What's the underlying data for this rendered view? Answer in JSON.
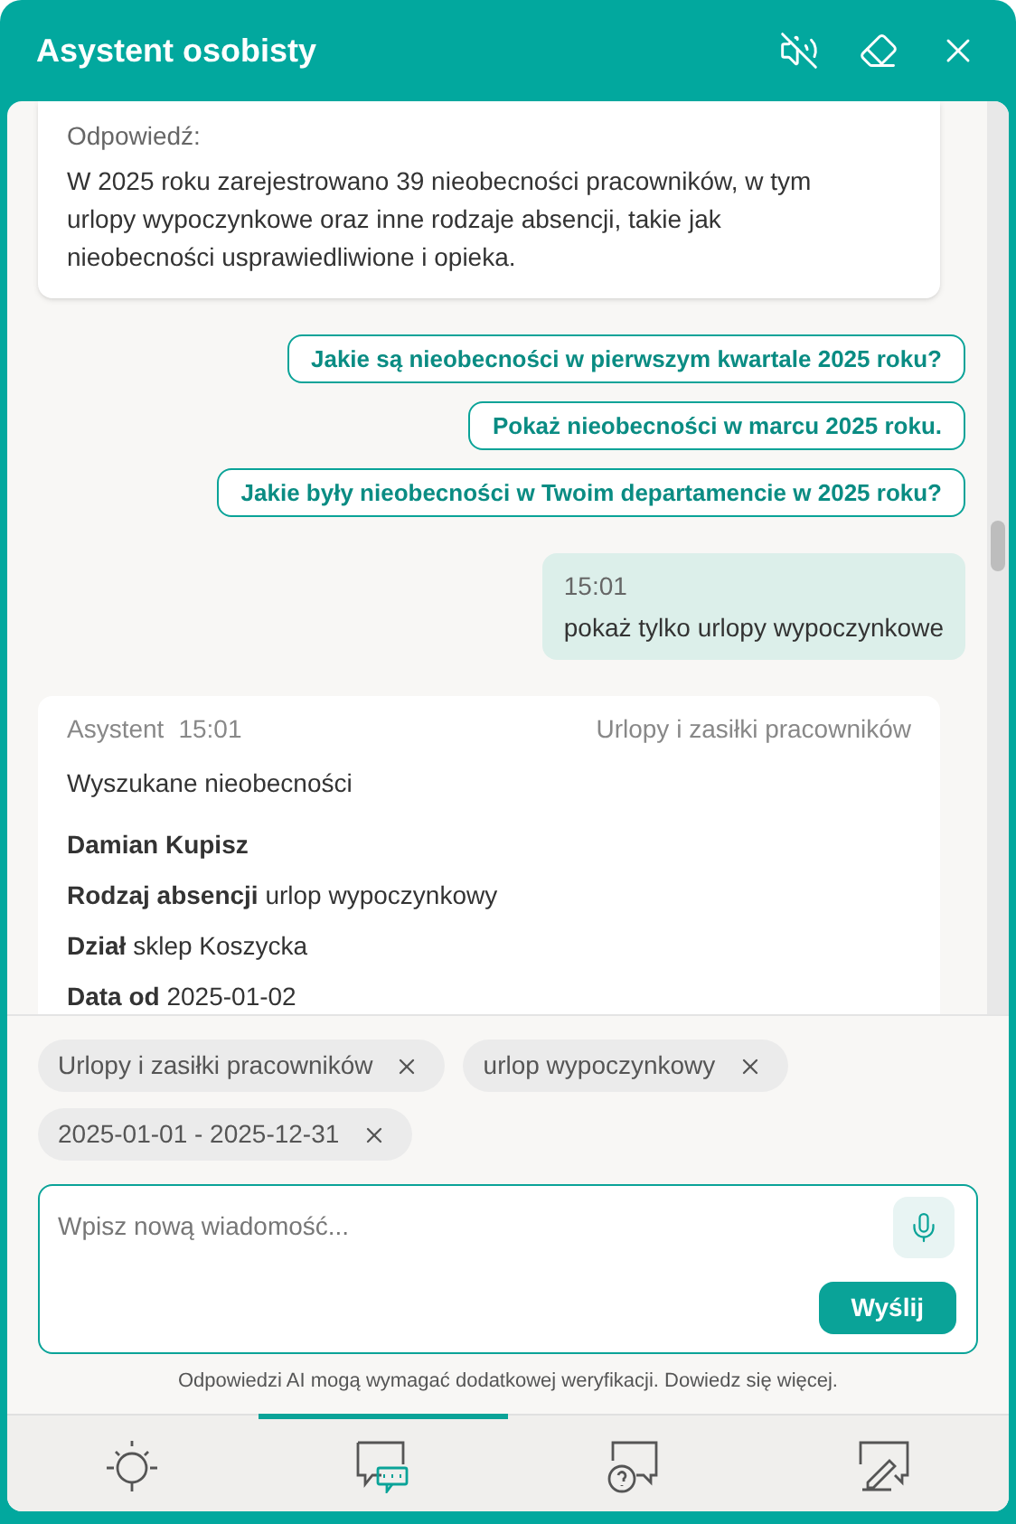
{
  "header": {
    "title": "Asystent osobisty"
  },
  "messages": [
    {
      "kind": "answer",
      "label": "Odpowiedź:",
      "text": "W 2025 roku zarejestrowano 39 nieobecności pracowników, w tym urlopy wypoczynkowe oraz inne rodzaje absencji, takie jak nieobecności usprawiedliwione i opieka."
    },
    {
      "kind": "suggestion",
      "text": "Jakie są nieobecności w pierwszym kwartale 2025 roku?"
    },
    {
      "kind": "suggestion",
      "text": "Pokaż nieobecności w marcu 2025 roku."
    },
    {
      "kind": "suggestion",
      "text": "Jakie były nieobecności w Twoim departamencie w 2025 roku?"
    },
    {
      "kind": "user",
      "time": "15:01",
      "text": "pokaż tylko urlopy wypoczynkowe"
    },
    {
      "kind": "assistant",
      "sender": "Asystent",
      "time": "15:01",
      "source": "Urlopy i zasiłki pracowników",
      "intro": "Wyszukane nieobecności",
      "name": "Damian Kupisz",
      "fields": [
        "**Rodzaj absencji** urlop wypoczynkowy",
        "**Dział** sklep Koszycka",
        "**Data od** 2025-01-02"
      ]
    }
  ],
  "filters": [
    {
      "label": "Urlopy i zasiłki pracowników"
    },
    {
      "label": "urlop wypoczynkowy"
    },
    {
      "label": "2025-01-01 - 2025-12-31"
    }
  ],
  "composer": {
    "placeholder": "Wpisz nową wiadomość...",
    "send": "Wyślij"
  },
  "disclaimer": "Odpowiedzi AI mogą wymagać dodatkowej weryfikacji. Dowiedz się więcej.",
  "nav": [
    {
      "kind": "tips",
      "selected": false
    },
    {
      "kind": "chat",
      "selected": true
    },
    {
      "kind": "help",
      "selected": false
    },
    {
      "kind": "feedback",
      "selected": false
    }
  ]
}
